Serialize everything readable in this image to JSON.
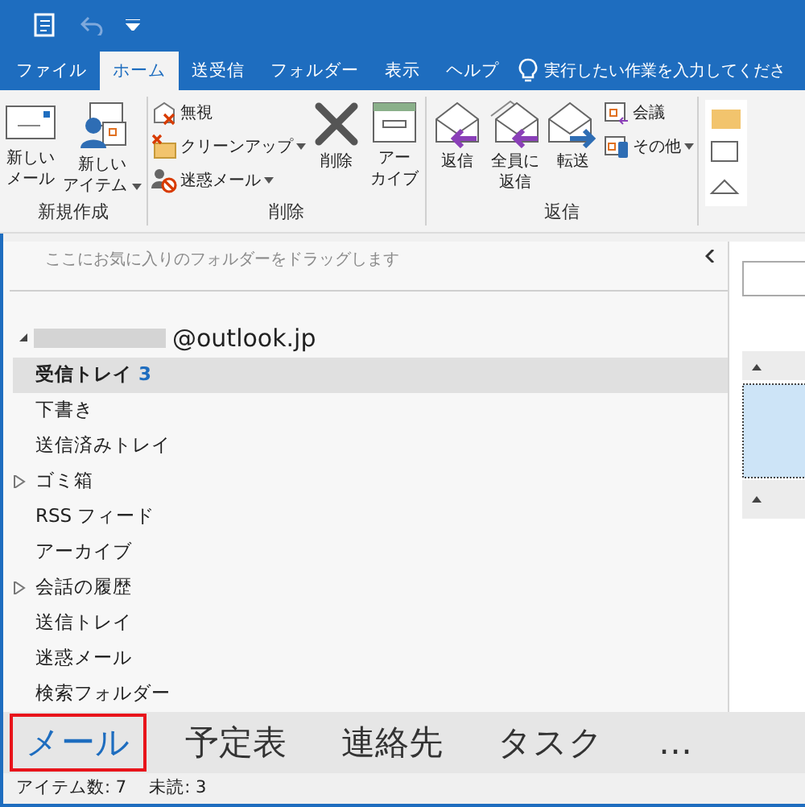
{
  "title_bar": {
    "quick_access": [
      {
        "kind": "app"
      },
      {
        "kind": "undo",
        "disabled": true
      },
      {
        "kind": "customize"
      }
    ]
  },
  "tabs": [
    {
      "label": "ファイル",
      "selected": false
    },
    {
      "label": "ホーム",
      "selected": true
    },
    {
      "label": "送受信",
      "selected": false
    },
    {
      "label": "フォルダー",
      "selected": false
    },
    {
      "label": "表示",
      "selected": false
    },
    {
      "label": "ヘルプ",
      "selected": false
    }
  ],
  "tell_me": {
    "placeholder": "実行したい作業を入力してくださ"
  },
  "ribbon": {
    "groups": [
      {
        "label": "新規作成",
        "items": [
          {
            "kind": "large",
            "lines": [
              "新しい",
              "メール"
            ],
            "dropdown": false
          },
          {
            "kind": "large",
            "lines": [
              "新しい",
              "アイテム"
            ],
            "dropdown": true
          }
        ]
      },
      {
        "label": "削除",
        "items": [
          {
            "kind": "stack",
            "buttons": [
              {
                "label": "無視",
                "dropdown": false
              },
              {
                "label": "クリーンアップ",
                "dropdown": true
              },
              {
                "label": "迷惑メール",
                "dropdown": true
              }
            ]
          },
          {
            "kind": "large",
            "lines": [
              "削除"
            ],
            "dropdown": false
          },
          {
            "kind": "large",
            "lines": [
              "アー",
              "カイブ"
            ],
            "dropdown": false
          }
        ]
      },
      {
        "label": "返信",
        "items": [
          {
            "kind": "large",
            "lines": [
              "返信"
            ],
            "dropdown": false
          },
          {
            "kind": "large",
            "lines": [
              "全員に",
              "返信"
            ],
            "dropdown": false
          },
          {
            "kind": "large",
            "lines": [
              "転送"
            ],
            "dropdown": false
          },
          {
            "kind": "stack",
            "buttons": [
              {
                "label": "会議",
                "dropdown": false
              },
              {
                "label": "その他",
                "dropdown": true
              }
            ]
          }
        ]
      }
    ]
  },
  "folder_pane": {
    "favorites_hint": "ここにお気に入りのフォルダーをドラッグします",
    "account": "@outlook.jp",
    "folders": [
      {
        "label": "受信トレイ",
        "count": "3",
        "selected": true,
        "expandable": false
      },
      {
        "label": "下書き",
        "selected": false,
        "expandable": false
      },
      {
        "label": "送信済みトレイ",
        "selected": false,
        "expandable": false
      },
      {
        "label": "ゴミ箱",
        "selected": false,
        "expandable": true
      },
      {
        "label": "RSS フィード",
        "selected": false,
        "expandable": false
      },
      {
        "label": "アーカイブ",
        "selected": false,
        "expandable": false
      },
      {
        "label": "会話の履歴",
        "selected": false,
        "expandable": true
      },
      {
        "label": "送信トレイ",
        "selected": false,
        "expandable": false
      },
      {
        "label": "迷惑メール",
        "selected": false,
        "expandable": false
      },
      {
        "label": "検索フォルダー",
        "selected": false,
        "expandable": false
      }
    ]
  },
  "navigation": [
    {
      "label": "メール",
      "selected": true
    },
    {
      "label": "予定表",
      "selected": false
    },
    {
      "label": "連絡先",
      "selected": false
    },
    {
      "label": "タスク",
      "selected": false
    },
    {
      "label": "…",
      "selected": false
    }
  ],
  "status_bar": [
    "アイテム数: 7",
    "未読: 3"
  ]
}
